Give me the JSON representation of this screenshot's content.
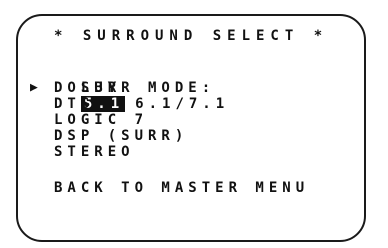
{
  "menu": {
    "title": "* SURROUND SELECT *",
    "surr_mode": {
      "label": "SURR MODE:",
      "options": [
        "5.1",
        "6.1/7.1"
      ],
      "selected": "5.1"
    },
    "cursor": "▶",
    "items": [
      "DOLBY",
      "DTS",
      "LOGIC 7",
      "DSP (SURR)",
      "STEREO"
    ],
    "back": "BACK TO MASTER MENU"
  }
}
